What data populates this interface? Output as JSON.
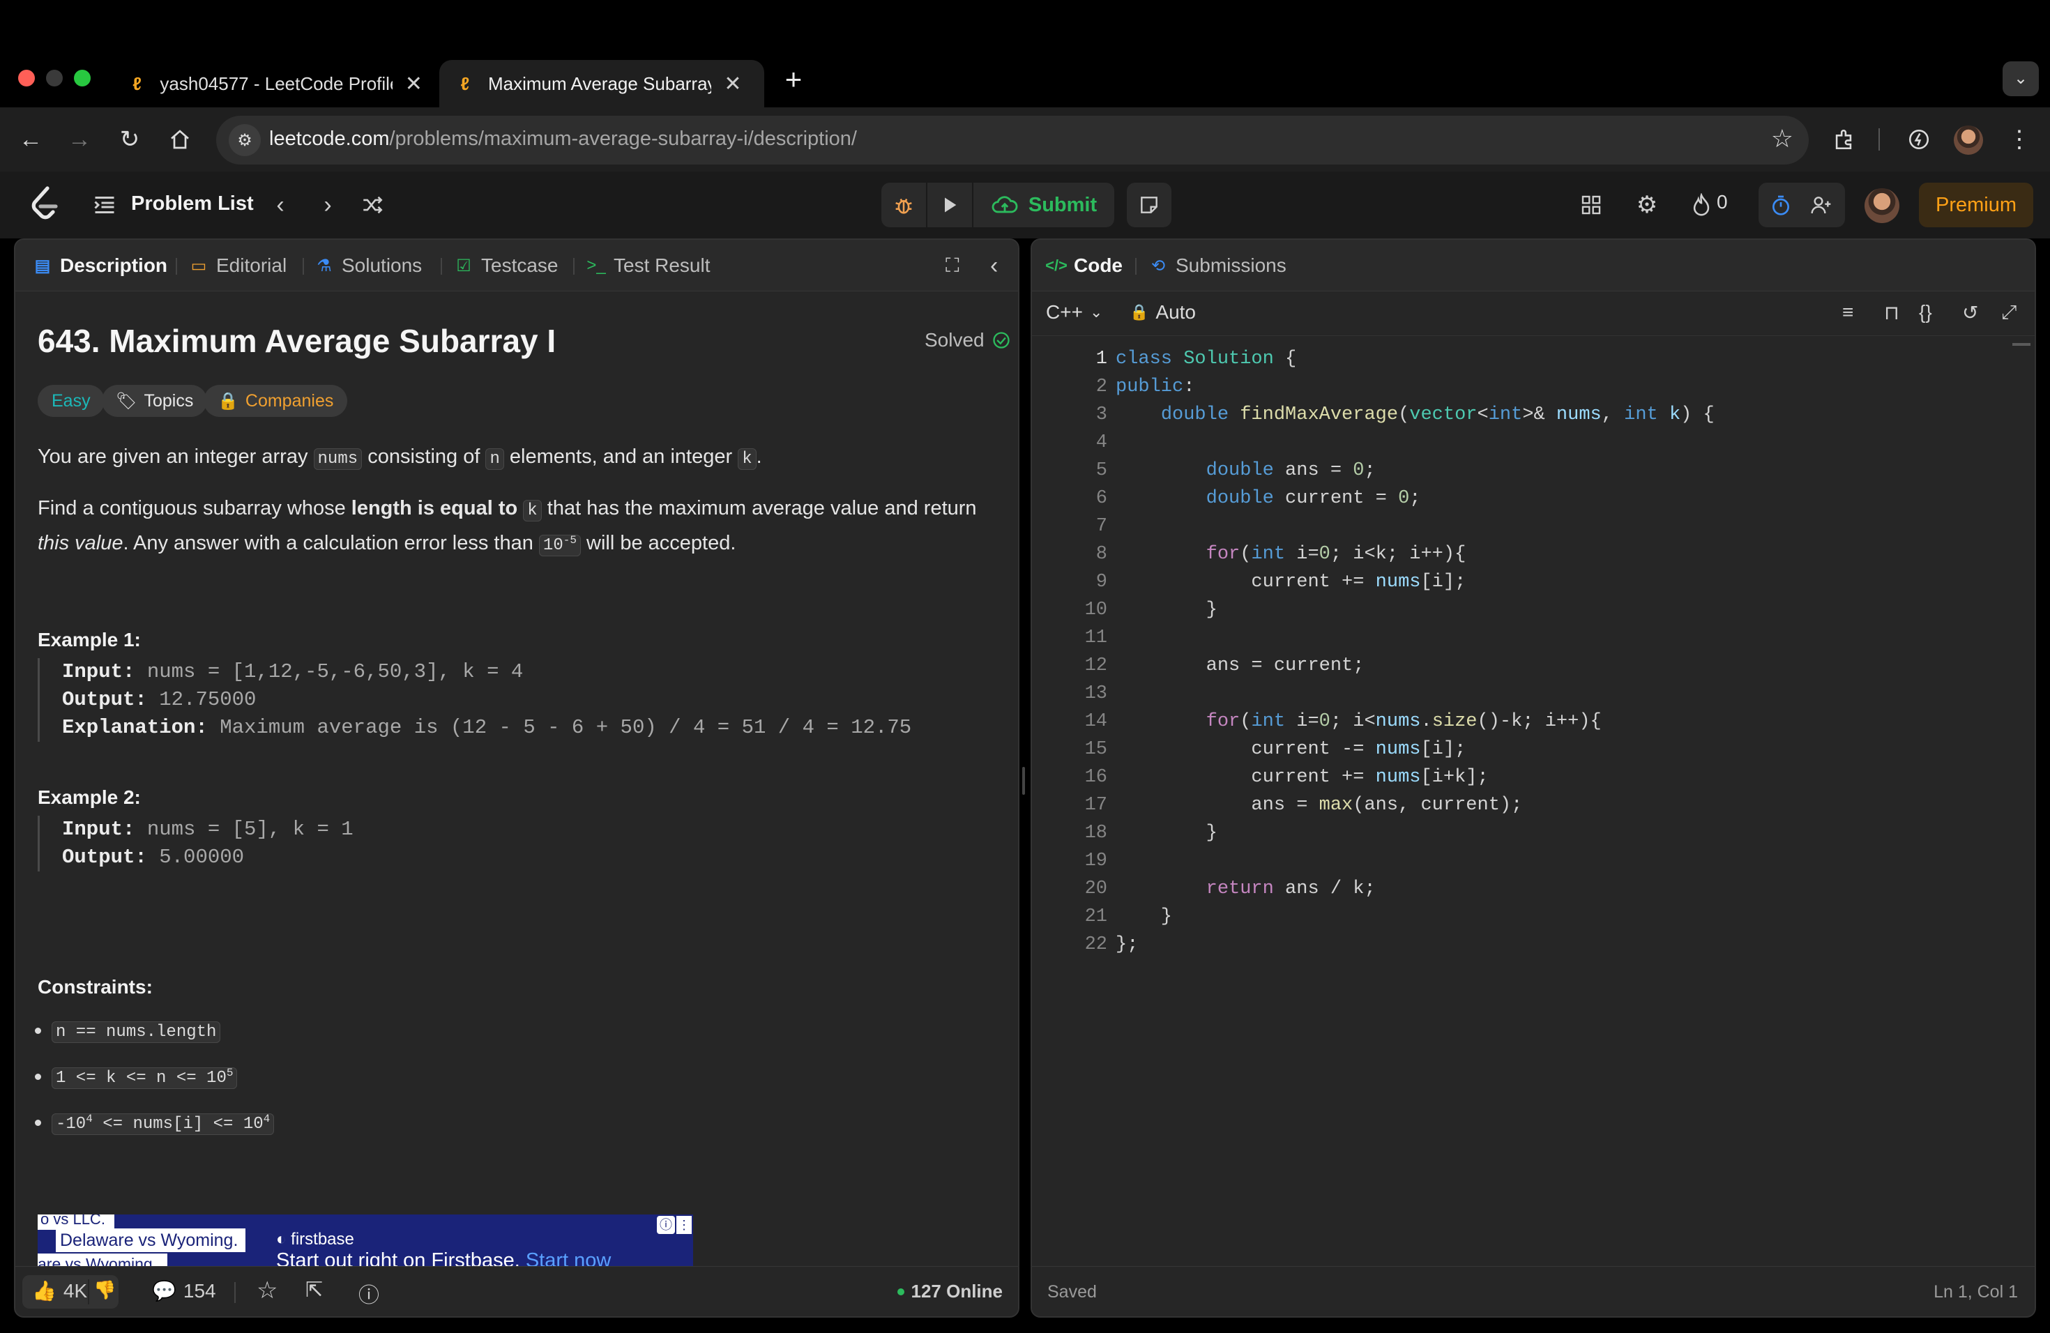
{
  "browser": {
    "tabs": [
      {
        "title": "yash04577 - LeetCode Profile",
        "active": false
      },
      {
        "title": "Maximum Average Subarray I",
        "active": true
      }
    ],
    "url_host": "leetcode.com",
    "url_path": "/problems/maximum-average-subarray-i/description/"
  },
  "header": {
    "problem_list": "Problem List",
    "submit": "Submit",
    "streak_count": "0",
    "premium": "Premium"
  },
  "left_panel": {
    "tabs": [
      {
        "label": "Description",
        "icon": "document-icon",
        "active": true
      },
      {
        "label": "Editorial",
        "icon": "book-icon"
      },
      {
        "label": "Solutions",
        "icon": "flask-icon"
      },
      {
        "label": "Testcase",
        "icon": "checkbox-icon"
      },
      {
        "label": "Test Result",
        "icon": "terminal-icon"
      }
    ],
    "title": "643. Maximum Average Subarray I",
    "status": "Solved",
    "difficulty": "Easy",
    "topics": "Topics",
    "companies": "Companies",
    "para1": {
      "a": "You are given an integer array ",
      "b": "nums",
      "c": " consisting of ",
      "d": "n",
      "e": " elements, and an integer ",
      "f": "k",
      "g": "."
    },
    "para2": {
      "a": "Find a contiguous subarray whose ",
      "b": "length is equal to",
      "c": " ",
      "d": "k",
      "e": " that has the maximum average value and return",
      "f": "this value",
      "g": ". Any answer with a calculation error less than ",
      "h": "10",
      "i": "-5",
      "j": " will be accepted."
    },
    "examples": [
      {
        "title": "Example 1:",
        "input_label": "Input:",
        "input": " nums = [1,12,-5,-6,50,3], k = 4",
        "output_label": "Output:",
        "output": " 12.75000",
        "explanation_label": "Explanation:",
        "explanation": " Maximum average is (12 - 5 - 6 + 50) / 4 = 51 / 4 = 12.75"
      },
      {
        "title": "Example 2:",
        "input_label": "Input:",
        "input": " nums = [5], k = 1",
        "output_label": "Output:",
        "output": " 5.00000"
      }
    ],
    "constraints_title": "Constraints:",
    "constraints": {
      "c1": "n == nums.length",
      "c2a": "1 <= k <= n <= 10",
      "c2b": "5",
      "c3a": "-10",
      "c3b": "4",
      "c3c": " <= nums[i] <= 10",
      "c3d": "4"
    },
    "ad": {
      "line1": "o vs LLC.",
      "line2": "Delaware vs Wyoming.",
      "line3": "are vs Wyoming.",
      "brand": "firstbase",
      "tagline": "Start out right on Firstbase.",
      "cta": "Start now"
    },
    "footer": {
      "likes": "4K",
      "comments": "154",
      "online": "127 Online"
    }
  },
  "right_panel": {
    "tabs": [
      {
        "label": "Code",
        "icon": "code-icon",
        "active": true
      },
      {
        "label": "Submissions",
        "icon": "history-icon"
      }
    ],
    "language": "C++",
    "autocomplete": "Auto",
    "footer": {
      "status": "Saved",
      "cursor": "Ln 1, Col 1"
    },
    "lines": [
      "1",
      "2",
      "3",
      "4",
      "5",
      "6",
      "7",
      "8",
      "9",
      "10",
      "11",
      "12",
      "13",
      "14",
      "15",
      "16",
      "17",
      "18",
      "19",
      "20",
      "21",
      "22"
    ]
  }
}
